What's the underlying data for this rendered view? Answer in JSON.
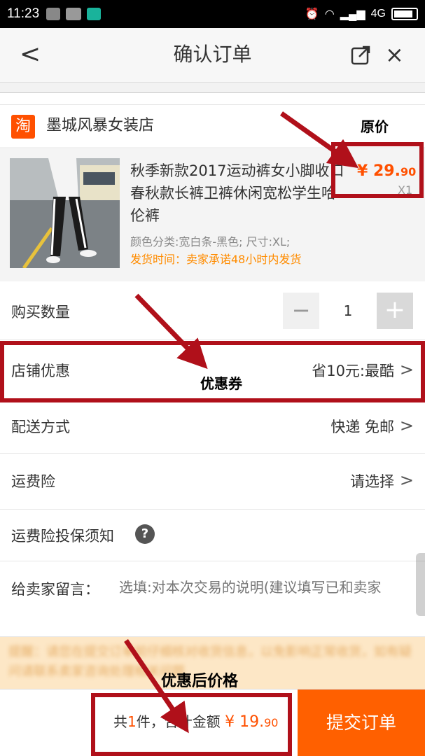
{
  "status_bar": {
    "time": "11:23",
    "network": "4G"
  },
  "nav": {
    "back_glyph": "<",
    "title": "确认订单",
    "close_glyph": "×"
  },
  "shop": {
    "logo": "淘",
    "name": "墨城风暴女装店"
  },
  "product": {
    "title": "秋季新款2017运动裤女小脚收口春秋款长裤卫裤休闲宽松学生哈伦裤",
    "sku": "颜色分类:宽白条-黑色; 尺寸:XL;",
    "shipping": "发货时间：卖家承诺48小时内发货",
    "price_int": "¥ 29.",
    "price_dec": "90",
    "qty": "X1"
  },
  "quantity": {
    "label": "购买数量",
    "minus": "−",
    "value": "1",
    "plus": "+"
  },
  "discount": {
    "label": "店铺优惠",
    "value": "省10元:最酷",
    "chevron": ">"
  },
  "delivery": {
    "label": "配送方式",
    "value": "快递 免邮",
    "chevron": ">"
  },
  "insurance": {
    "label": "运费险",
    "value": "请选择",
    "chevron": ">"
  },
  "insurance_notice": {
    "label": "运费险投保须知",
    "help": "?"
  },
  "message": {
    "label": "给卖家留言：",
    "placeholder": "选填:对本次交易的说明(建议填写已和卖家"
  },
  "notice": {
    "text": "提醒：请您在提交订单前仔细核对收货信息，以免影响正常收货，如有疑问请联系卖家咨询处理相关问题"
  },
  "bottom": {
    "total_prefix": "共",
    "count": "1",
    "total_mid": "件，合计金额",
    "amount_int": "¥ 19.",
    "amount_dec": "90",
    "submit_label": "提交订单"
  },
  "annotations": {
    "original_price": "原价",
    "coupon": "优惠券",
    "discounted_price": "优惠后价格"
  },
  "colors": {
    "accent": "#ff5000",
    "submit": "#ff6000",
    "annotation": "#b0101a"
  }
}
